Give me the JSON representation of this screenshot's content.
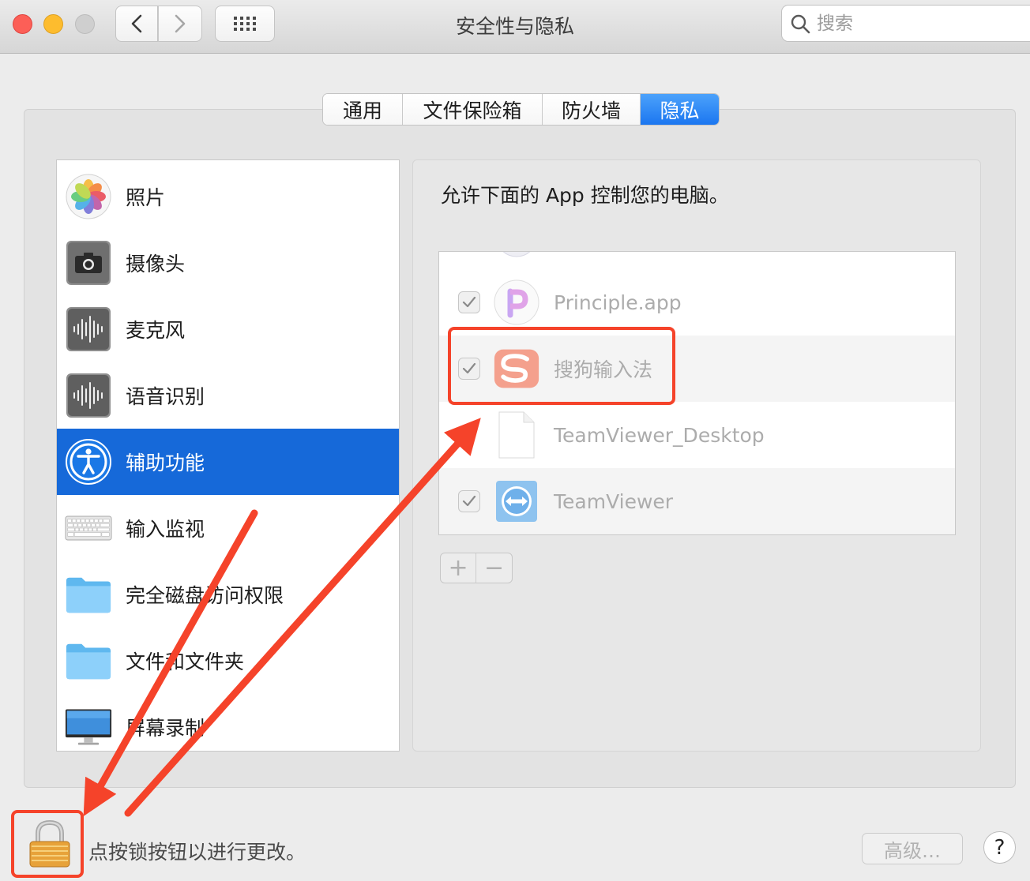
{
  "window": {
    "title": "安全性与隐私"
  },
  "toolbar": {
    "back_icon": "chevron-left-icon",
    "forward_icon": "chevron-right-icon",
    "grid_icon": "show-all-grid-icon"
  },
  "search": {
    "placeholder": "搜索",
    "value": ""
  },
  "tabs": [
    {
      "label": "通用",
      "active": false
    },
    {
      "label": "文件保险箱",
      "active": false
    },
    {
      "label": "防火墙",
      "active": false
    },
    {
      "label": "隐私",
      "active": true
    }
  ],
  "sidebar": {
    "items": [
      {
        "label": "照片",
        "icon": "photos-icon",
        "selected": false
      },
      {
        "label": "摄像头",
        "icon": "camera-icon",
        "selected": false
      },
      {
        "label": "麦克风",
        "icon": "microphone-icon",
        "selected": false
      },
      {
        "label": "语音识别",
        "icon": "speech-recognition-icon",
        "selected": false
      },
      {
        "label": "辅助功能",
        "icon": "accessibility-icon",
        "selected": true
      },
      {
        "label": "输入监视",
        "icon": "keyboard-icon",
        "selected": false
      },
      {
        "label": "完全磁盘访问权限",
        "icon": "folder-icon",
        "selected": false
      },
      {
        "label": "文件和文件夹",
        "icon": "folder-icon",
        "selected": false
      },
      {
        "label": "屏幕录制",
        "icon": "display-icon",
        "selected": false
      }
    ]
  },
  "main": {
    "description": "允许下面的 App 控制您的电脑。",
    "apps": [
      {
        "name": "Principle.app",
        "checked": true,
        "icon": "principle-app-icon"
      },
      {
        "name": "搜狗输入法",
        "checked": true,
        "icon": "sogou-input-icon"
      },
      {
        "name": "TeamViewer_Desktop",
        "checked": false,
        "icon": "generic-document-icon"
      },
      {
        "name": "TeamViewer",
        "checked": true,
        "icon": "teamviewer-icon"
      }
    ],
    "add_label": "+",
    "remove_label": "−"
  },
  "footer": {
    "lock_text": "点按锁按钮以进行更改。",
    "advanced_label": "高级…",
    "help_label": "?",
    "lock_icon": "lock-icon"
  },
  "colors": {
    "accent": "#1669d9",
    "annotation": "#f5432a"
  }
}
